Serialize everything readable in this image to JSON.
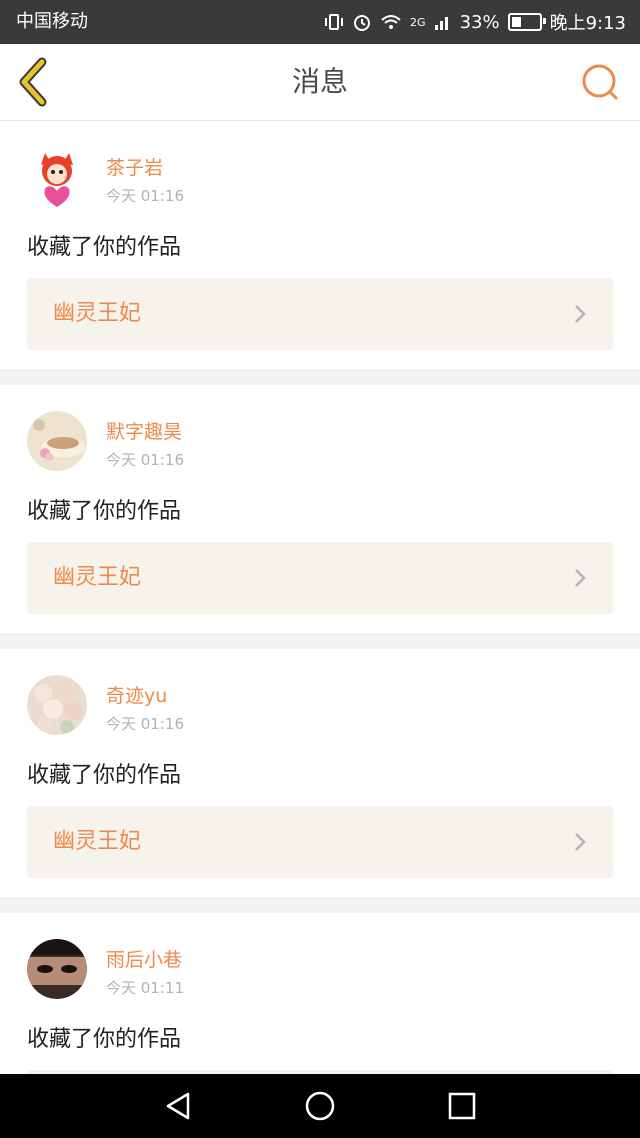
{
  "status_bar": {
    "carrier": "中国移动",
    "battery_percent": "33%",
    "battery_level": 0.33,
    "network": "2G",
    "time": "晚上9:13"
  },
  "header": {
    "title": "消息",
    "back_icon": "back-chevron-icon",
    "search_icon": "search-icon"
  },
  "messages": [
    {
      "username": "茶子岩",
      "time": "今天 01:16",
      "action": "收藏了你的作品",
      "work_title": "幽灵王妃",
      "avatar": "cartoon-avatar"
    },
    {
      "username": "默字趣昊",
      "time": "今天 01:16",
      "action": "收藏了你的作品",
      "work_title": "幽灵王妃",
      "avatar": "teacup-avatar"
    },
    {
      "username": "奇迹yu",
      "time": "今天 01:16",
      "action": "收藏了你的作品",
      "work_title": "幽灵王妃",
      "avatar": "flowers-avatar"
    },
    {
      "username": "雨后小巷",
      "time": "今天 01:11",
      "action": "收藏了你的作品",
      "work_title": "",
      "avatar": "face-avatar"
    }
  ],
  "colors": {
    "accent": "#f08a4b",
    "back_icon": "#e8c32c",
    "work_bg": "#f5f3ec",
    "status_bar_bg": "#3a3a3a",
    "nav_bar_bg": "#000000"
  },
  "system_nav": {
    "back_icon": "triangle-back-icon",
    "home_icon": "circle-home-icon",
    "recents_icon": "square-recents-icon"
  }
}
